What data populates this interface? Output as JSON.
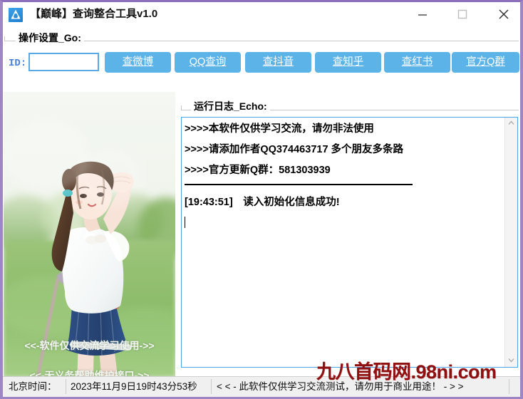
{
  "window": {
    "title": "【巅峰】查询整合工具v1.0",
    "app_icon": "app-logo-icon",
    "minimize_label": "minimize-icon",
    "maximize_label": "maximize-icon",
    "close_label": "close-icon",
    "border_color": "#9e86c4"
  },
  "settings_group": {
    "label": "操作设置_Go:"
  },
  "id_field": {
    "label": "ID:",
    "value": "",
    "placeholder": ""
  },
  "actions": [
    {
      "label": "查微博",
      "name": "query-weibo-button"
    },
    {
      "label": "QQ查询",
      "name": "query-qq-button"
    },
    {
      "label": "查抖音",
      "name": "query-douyin-button"
    },
    {
      "label": "查知乎",
      "name": "query-zhihu-button"
    },
    {
      "label": "查红书",
      "name": "query-xiaohongshu-button"
    },
    {
      "label": "官方Q群",
      "name": "official-qq-group-button"
    }
  ],
  "action_button_color": "#5cb3e8",
  "picture": {
    "overlay_line_1": "<<-软件仅供交流学习使用->>",
    "overlay_line_2": "<<-无义务帮助维护接口->>"
  },
  "log_group": {
    "label": "运行日志_Echo:"
  },
  "log": {
    "lines": [
      ">>>>本软件仅供学习交流，请勿非法使用",
      ">>>>请添加作者QQ374463717 多个朋友多条路",
      ">>>>官方更新Q群：581303939"
    ],
    "entry": "[19:43:51]　读入初始化信息成功!"
  },
  "watermark": "九八首码网.98ni.com",
  "statusbar": {
    "time_label": "北京时间：",
    "time_value": "2023年11月9日19时43分53秒",
    "notice": "< < -  此软件仅供学习交流测试，请勿用于商业用途！  -  > >"
  }
}
